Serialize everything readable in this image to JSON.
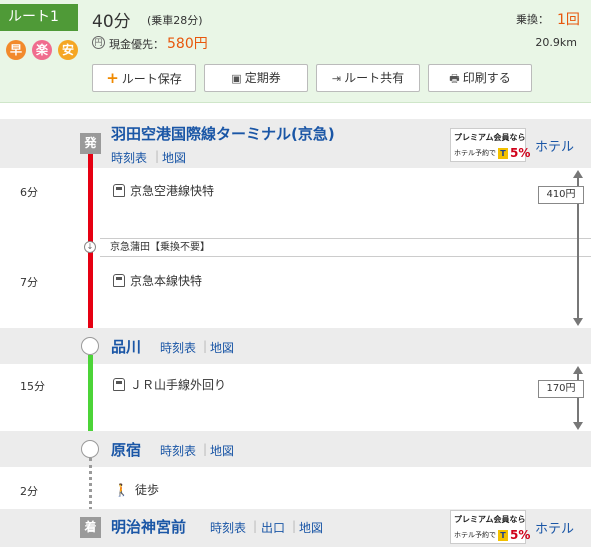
{
  "summary": {
    "route_label": "ルート1",
    "badges": [
      "早",
      "楽",
      "安"
    ],
    "total_time": "40分",
    "ride_time": "(乗車28分)",
    "fare_icon": "円",
    "fare_label": "現金優先：",
    "fare_value": "580円",
    "transfer_label": "乗換：",
    "transfer_value": "1回",
    "distance": "20.9km",
    "buttons": {
      "save": {
        "icon": "+",
        "label": "ルート保存"
      },
      "pass": {
        "icon": "▣",
        "label": "定期券"
      },
      "share": {
        "icon": "⇥",
        "label": "ルート共有"
      },
      "print": {
        "icon": "🖶",
        "label": "印刷する"
      }
    }
  },
  "route": {
    "departure": {
      "mark": "発",
      "name": "羽田空港国際線ターミナル(京急)",
      "links": [
        "時刻表",
        "地図"
      ],
      "hotel": "ホテル"
    },
    "seg1": {
      "minutes": "6分",
      "line": "京急空港線快特"
    },
    "through_stop": "京急蒲田【乗換不要】",
    "seg2": {
      "minutes": "7分",
      "line": "京急本線快特"
    },
    "fare1": "410円",
    "station2": {
      "name": "品川",
      "links": [
        "時刻表",
        "地図"
      ]
    },
    "seg3": {
      "minutes": "15分",
      "line": "ＪＲ山手線外回り"
    },
    "fare2": "170円",
    "station3": {
      "name": "原宿",
      "links": [
        "時刻表",
        "地図"
      ]
    },
    "seg4": {
      "minutes": "2分",
      "line": "徒歩"
    },
    "arrival": {
      "mark": "着",
      "name": "明治神宮前",
      "links": [
        "時刻表",
        "出口",
        "地図"
      ],
      "hotel": "ホテル"
    },
    "promo": {
      "top": "プレミアム会員なら",
      "bottom": "ホテル予約で",
      "t": "T",
      "pct": "5%"
    }
  },
  "colors": {
    "keikyu": "#e60012",
    "yamanote": "#4cd438",
    "walk": "#9a9a9a",
    "fare": "#e8570c",
    "link": "#1a56a6"
  }
}
